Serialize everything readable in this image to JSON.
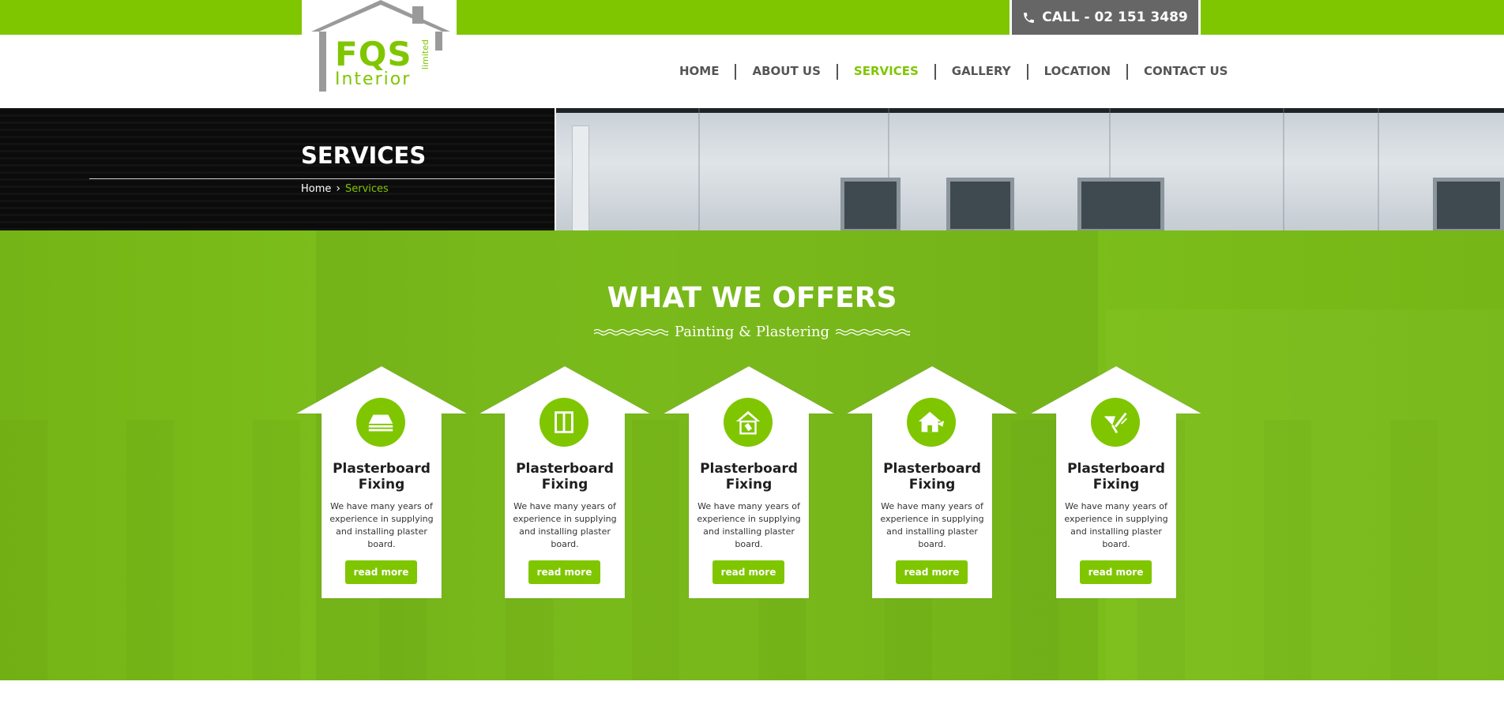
{
  "contact": {
    "call_label": "CALL - 02 151 3489",
    "icon": "phone-icon"
  },
  "logo": {
    "brand": "FQS",
    "sub": "Interior",
    "tag": "limited"
  },
  "nav": {
    "items": [
      {
        "label": "HOME"
      },
      {
        "label": "ABOUT US"
      },
      {
        "label": "SERVICES",
        "active": true
      },
      {
        "label": "GALLERY"
      },
      {
        "label": "LOCATION"
      },
      {
        "label": "CONTACT US"
      }
    ]
  },
  "banner": {
    "title": "SERVICES",
    "breadcrumb": {
      "home": "Home",
      "current": "Services"
    }
  },
  "services": {
    "title": "WHAT WE OFFERS",
    "subtitle": "Painting & Plastering",
    "cards": [
      {
        "icon": "plasterboard-stack-icon",
        "title": "Plasterboard Fixing",
        "text": "We have many years of experience in supplying and installing plaster board.",
        "button": "read more"
      },
      {
        "icon": "panel-door-icon",
        "title": "Plasterboard Fixing",
        "text": "We have many years of experience in supplying and installing plaster board.",
        "button": "read more"
      },
      {
        "icon": "house-brush-icon",
        "title": "Plasterboard Fixing",
        "text": "We have many years of experience in supplying and installing plaster board.",
        "button": "read more"
      },
      {
        "icon": "house-trowel-icon",
        "title": "Plasterboard Fixing",
        "text": "We have many years of experience in supplying and installing plaster board.",
        "button": "read more"
      },
      {
        "icon": "trowel-brush-icon",
        "title": "Plasterboard Fixing",
        "text": "We have many years of experience in supplying and installing plaster board.",
        "button": "read more"
      }
    ]
  },
  "colors": {
    "accent": "#7fc600",
    "call_bg": "#666666",
    "nav_text": "#555555",
    "banner_dark": "#0b0b0b"
  }
}
